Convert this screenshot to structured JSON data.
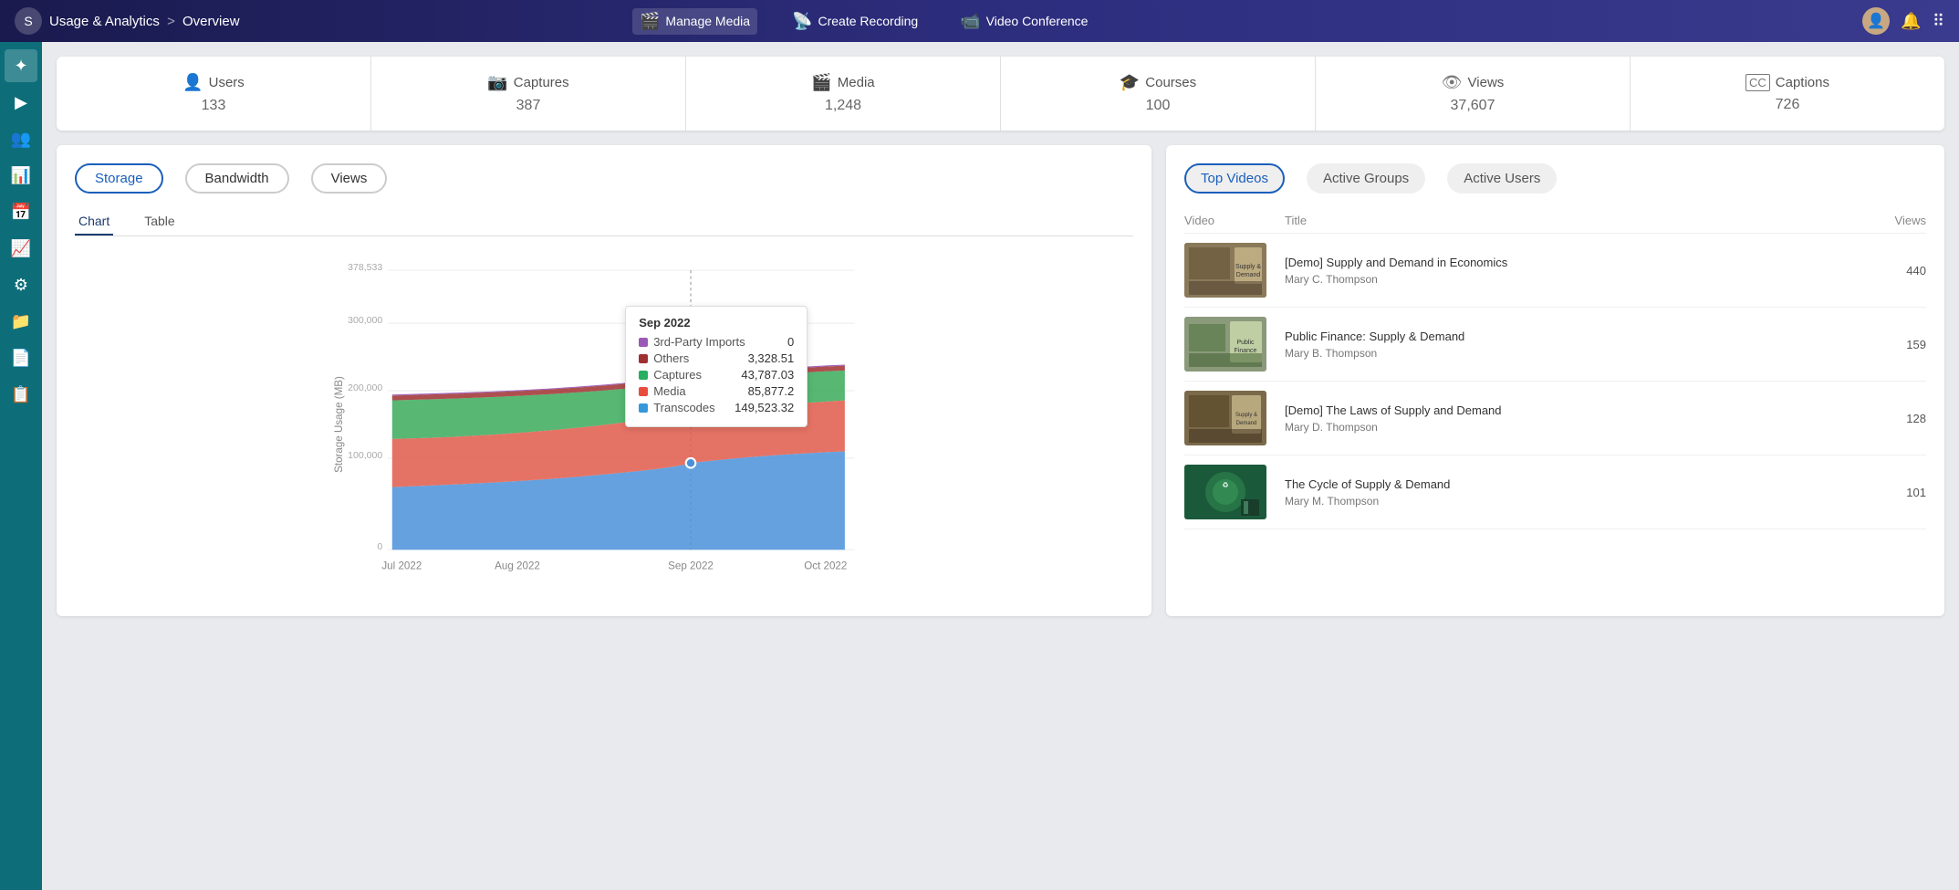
{
  "app": {
    "logo_text": "S",
    "breadcrumb1": "Usage & Analytics",
    "breadcrumb_sep": ">",
    "breadcrumb2": "Overview"
  },
  "top_nav": {
    "items": [
      {
        "id": "manage-media",
        "label": "Manage Media",
        "icon": "🎬",
        "active": true
      },
      {
        "id": "create-recording",
        "label": "Create Recording",
        "icon": "📡",
        "active": false
      },
      {
        "id": "video-conference",
        "label": "Video Conference",
        "icon": "📹",
        "active": false
      }
    ]
  },
  "sidebar": {
    "items": [
      {
        "id": "home",
        "icon": "✦",
        "active": true
      },
      {
        "id": "play",
        "icon": "▶",
        "active": false
      },
      {
        "id": "users",
        "icon": "👥",
        "active": false
      },
      {
        "id": "analytics",
        "icon": "📊",
        "active": false
      },
      {
        "id": "calendar",
        "icon": "📅",
        "active": false
      },
      {
        "id": "chart",
        "icon": "📈",
        "active": false
      },
      {
        "id": "settings",
        "icon": "⚙",
        "active": false
      },
      {
        "id": "files",
        "icon": "📁",
        "active": false
      },
      {
        "id": "reports",
        "icon": "📄",
        "active": false
      },
      {
        "id": "clipboard",
        "icon": "📋",
        "active": false
      }
    ]
  },
  "stats": [
    {
      "id": "users",
      "icon": "👤",
      "label": "Users",
      "value": "133"
    },
    {
      "id": "captures",
      "icon": "📷",
      "label": "Captures",
      "value": "387"
    },
    {
      "id": "media",
      "icon": "🎬",
      "label": "Media",
      "value": "1,248"
    },
    {
      "id": "courses",
      "icon": "🎓",
      "label": "Courses",
      "value": "100"
    },
    {
      "id": "views",
      "icon": "👁",
      "label": "Views",
      "value": "37,607"
    },
    {
      "id": "captions",
      "icon": "CC",
      "label": "Captions",
      "value": "726"
    }
  ],
  "chart_panel": {
    "main_tabs": [
      {
        "id": "storage",
        "label": "Storage",
        "active": true
      },
      {
        "id": "bandwidth",
        "label": "Bandwidth",
        "active": false
      },
      {
        "id": "views",
        "label": "Views",
        "active": false
      }
    ],
    "sub_tabs": [
      {
        "id": "chart",
        "label": "Chart",
        "active": true
      },
      {
        "id": "table",
        "label": "Table",
        "active": false
      }
    ],
    "y_axis_label": "Storage Usage (MB)",
    "y_labels": [
      "378,533",
      "300,000",
      "200,000",
      "100,000",
      "0"
    ],
    "x_labels": [
      "Jul 2022",
      "Aug 2022",
      "Sep 2022",
      "Oct 2022"
    ],
    "tooltip": {
      "title": "Sep 2022",
      "items": [
        {
          "color": "#9b59b6",
          "label": "3rd-Party Imports",
          "value": "0"
        },
        {
          "color": "#c0392b",
          "label": "Others",
          "value": "3,328.51"
        },
        {
          "color": "#27ae60",
          "label": "Captures",
          "value": "43,787.03"
        },
        {
          "color": "#e74c3c",
          "label": "Media",
          "value": "85,877.2"
        },
        {
          "color": "#3498db",
          "label": "Transcodes",
          "value": "149,523.32"
        }
      ]
    }
  },
  "right_panel": {
    "tabs": [
      {
        "id": "top-videos",
        "label": "Top Videos",
        "active": true
      },
      {
        "id": "active-groups",
        "label": "Active Groups",
        "active": false
      },
      {
        "id": "active-users",
        "label": "Active Users",
        "active": false
      }
    ],
    "table_headers": {
      "video": "Video",
      "title": "Title",
      "views": "Views"
    },
    "videos": [
      {
        "id": 1,
        "thumb_color": "#8a7a5a",
        "title": "[Demo] Supply and Demand in Economics",
        "author": "Mary C. Thompson",
        "views": "440"
      },
      {
        "id": 2,
        "thumb_color": "#6a8a5a",
        "title": "Public Finance: Supply & Demand",
        "author": "Mary B. Thompson",
        "views": "159"
      },
      {
        "id": 3,
        "thumb_color": "#7a6a4a",
        "title": "[Demo] The Laws of Supply and Demand",
        "author": "Mary D. Thompson",
        "views": "128"
      },
      {
        "id": 4,
        "thumb_color": "#2a6a4a",
        "title": "The Cycle of Supply & Demand",
        "author": "Mary M. Thompson",
        "views": "101"
      }
    ]
  }
}
